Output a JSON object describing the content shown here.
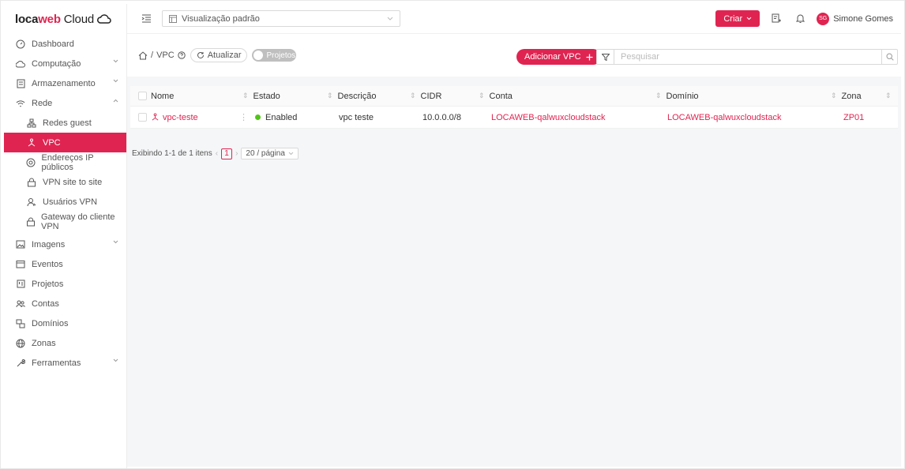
{
  "brand": {
    "name_part1": "loca",
    "name_part2": "web",
    "name_part3": "Cloud",
    "accent": "#e02451"
  },
  "sidebar": {
    "items": [
      {
        "label": "Dashboard",
        "icon": "dashboard-icon"
      },
      {
        "label": "Computação",
        "icon": "cloud-icon"
      },
      {
        "label": "Armazenamento",
        "icon": "storage-icon"
      },
      {
        "label": "Rede",
        "icon": "wifi-icon"
      },
      {
        "label": "Redes guest",
        "icon": "network-icon"
      },
      {
        "label": "VPC",
        "icon": "vpc-icon"
      },
      {
        "label": "Endereços IP públicos",
        "icon": "location-icon"
      },
      {
        "label": "VPN site to site",
        "icon": "lock-icon"
      },
      {
        "label": "Usuários VPN",
        "icon": "user-icon"
      },
      {
        "label": "Gateway do cliente VPN",
        "icon": "lock-icon"
      },
      {
        "label": "Imagens",
        "icon": "image-icon"
      },
      {
        "label": "Eventos",
        "icon": "calendar-icon"
      },
      {
        "label": "Projetos",
        "icon": "project-icon"
      },
      {
        "label": "Contas",
        "icon": "team-icon"
      },
      {
        "label": "Domínios",
        "icon": "domain-icon"
      },
      {
        "label": "Zonas",
        "icon": "globe-icon"
      },
      {
        "label": "Ferramentas",
        "icon": "tool-icon"
      }
    ]
  },
  "topbar": {
    "view_label": "Visualização padrão",
    "create_label": "Criar",
    "user_initials": "SG",
    "user_name": "Simone Gomes"
  },
  "toolbar": {
    "breadcrumb_sep": "/",
    "breadcrumb_page": "VPC",
    "refresh_label": "Atualizar",
    "projects_toggle_label": "Projetos",
    "add_label": "Adicionar VPC",
    "search_placeholder": "Pesquisar"
  },
  "table": {
    "columns": [
      "Nome",
      "Estado",
      "Descrição",
      "CIDR",
      "Conta",
      "Domínio",
      "Zona"
    ],
    "rows": [
      {
        "name": "vpc-teste",
        "state": "Enabled",
        "description": "vpc teste",
        "cidr": "10.0.0.0/8",
        "account": "LOCAWEB-qalwuxcloudstack",
        "domain": "LOCAWEB-qalwuxcloudstack",
        "zone": "ZP01"
      }
    ]
  },
  "pagination": {
    "summary": "Exibindo 1-1 de 1 itens",
    "current_page": "1",
    "page_size": "20 / página"
  }
}
